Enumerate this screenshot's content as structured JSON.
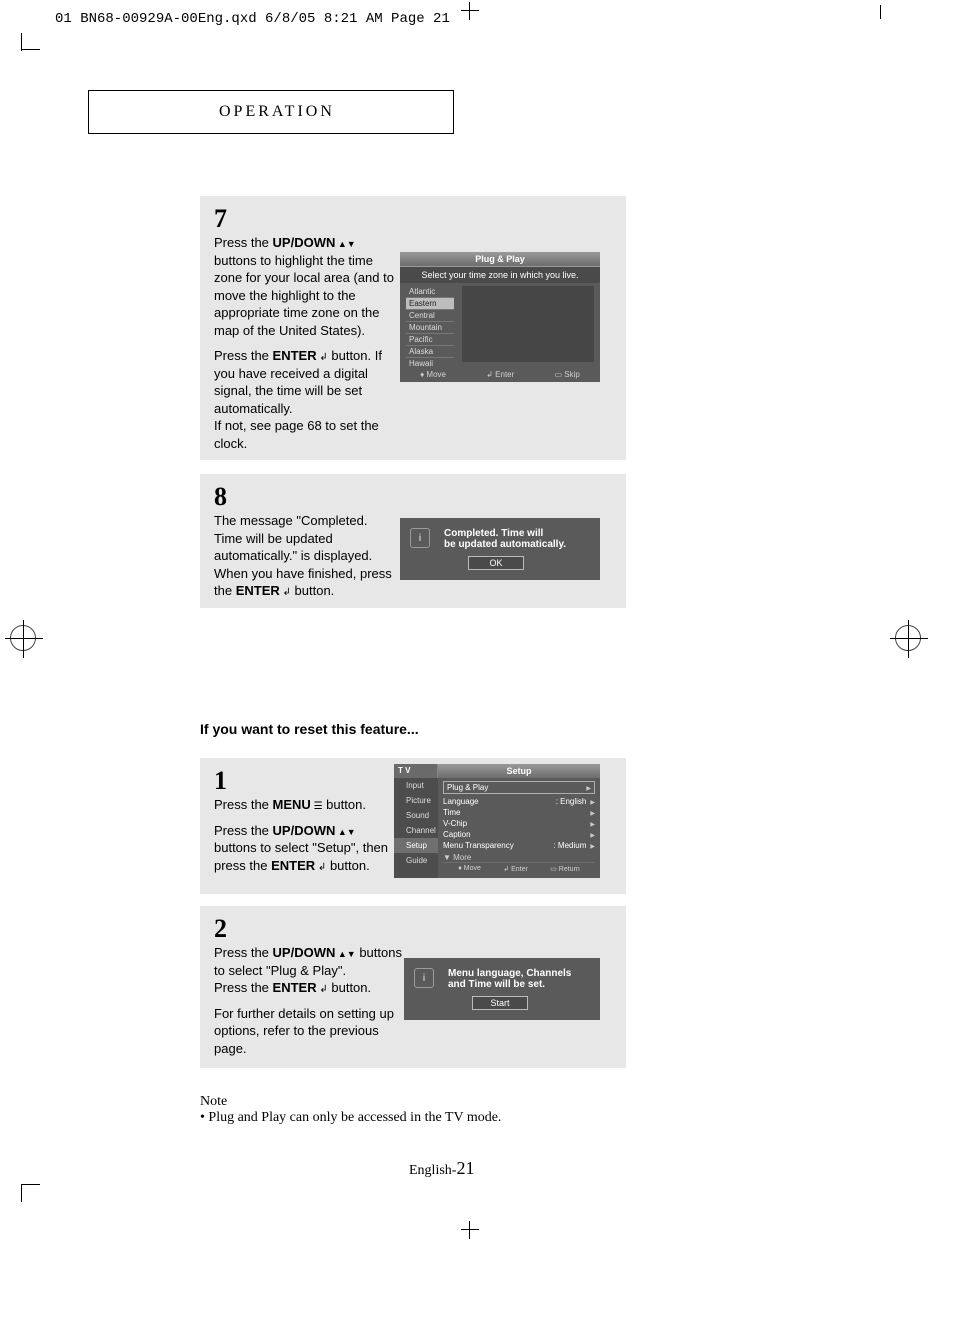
{
  "header_line": "01 BN68-00929A-00Eng.qxd  6/8/05 8:21 AM  Page 21",
  "section_title": "OPERATION",
  "step7": {
    "num": "7",
    "para1_a": "Press the ",
    "para1_b": "UP/DOWN",
    "para1_c": " buttons to highlight the time zone for your local area (and to move the  highlight to the appropriate time zone on the map of the United States).",
    "para2_a": "Press the ",
    "para2_b": "ENTER",
    "para2_c": " button. If you have received a digital signal, the time will be set automatically.",
    "para2_d": "If not, see page 68 to set the clock."
  },
  "osd7": {
    "title": "Plug & Play",
    "subtitle": "Select your time zone in which you live.",
    "zones": [
      "Atlantic",
      "Eastern",
      "Central",
      "Mountain",
      "Pacific",
      "Alaska",
      "Hawaii"
    ],
    "foot_move": "Move",
    "foot_enter": "Enter",
    "foot_skip": "Skip"
  },
  "step8": {
    "num": "8",
    "para_a": "The message \"Completed. Time will be updated automatically.\" is displayed. When you have finished, press the ",
    "para_b": "ENTER",
    "para_c": " button."
  },
  "modal8": {
    "line1": "Completed. Time will",
    "line2": "be updated automatically.",
    "btn": "OK"
  },
  "reset_title": "If you want to reset this feature...",
  "step1": {
    "num": "1",
    "p1_a": "Press the ",
    "p1_b": "MENU",
    "p1_c": " button.",
    "p2_a": "Press the ",
    "p2_b": "UP/DOWN",
    "p2_c": " buttons to select \"Setup\", then press the ",
    "p2_d": "ENTER",
    "p2_e": " button."
  },
  "tvosd": {
    "tl": "T V",
    "tr": "Setup",
    "side": [
      "Input",
      "Picture",
      "Sound",
      "Channel",
      "Setup",
      "Guide"
    ],
    "menu": {
      "plug": "Plug & Play",
      "lang_l": "Language",
      "lang_v": ": English",
      "time": "Time",
      "vchip": "V-Chip",
      "caption": "Caption",
      "mt_l": "Menu Transparency",
      "mt_v": ": Medium",
      "more": "▼  More"
    },
    "foot_move": "Move",
    "foot_enter": "Enter",
    "foot_return": "Return"
  },
  "step2": {
    "num": "2",
    "p1_a": "Press the ",
    "p1_b": "UP/DOWN",
    "p1_c": " buttons to select \"Plug & Play\".",
    "p1_d": "Press the ",
    "p1_e": "ENTER",
    "p1_f": "  button.",
    "p2": "For further details on setting up options, refer to the previous page."
  },
  "modal2": {
    "line1": "Menu language, Channels",
    "line2": "and Time will be set.",
    "btn": "Start"
  },
  "note": {
    "h": "Note",
    "b": "• Plug and Play can only be accessed in the TV mode."
  },
  "page": {
    "prefix": "English-",
    "num": "21"
  }
}
